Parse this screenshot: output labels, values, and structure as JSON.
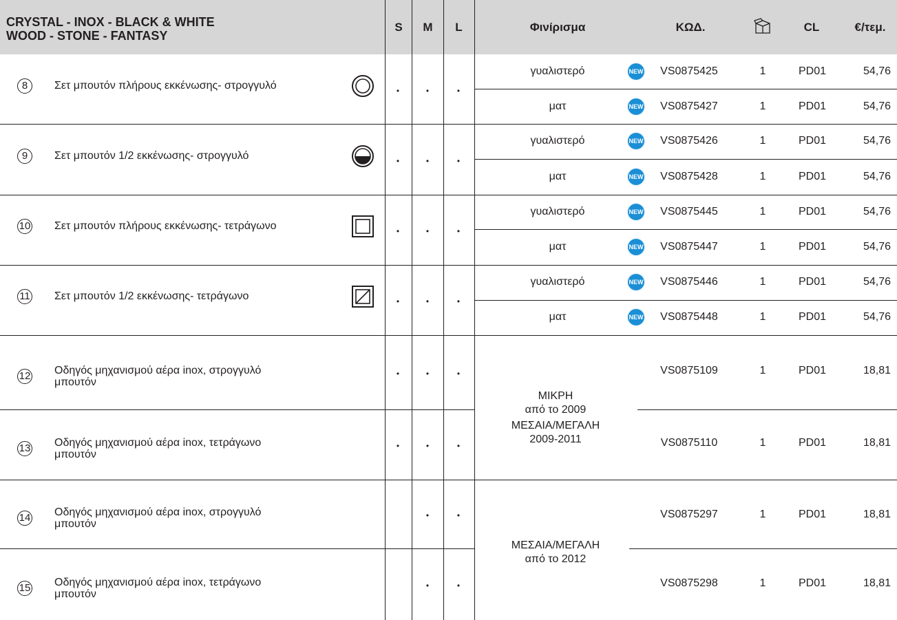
{
  "header": {
    "title_line1": "CRYSTAL - INOX - BLACK & WHITE",
    "title_line2": "WOOD - STONE - FANTASY",
    "col_s": "S",
    "col_m": "M",
    "col_l": "L",
    "col_finish": "Φινίρισμα",
    "col_code": "ΚΩΔ.",
    "col_box_icon": "box-icon",
    "col_cl": "CL",
    "col_price": "€/τεμ."
  },
  "badge_text": "NEW",
  "dot": "•",
  "groups": [
    {
      "num": "8",
      "desc_line1": "Σετ μπουτόν πλήρους εκκένωσης- στρογγυλό",
      "desc_line2": "",
      "icon": "round-full-flush-icon",
      "s": "•",
      "m": "•",
      "l": "•"
    },
    {
      "num": "9",
      "desc_line1": "Σετ μπουτόν 1/2 εκκένωσης- στρογγυλό",
      "desc_line2": "",
      "icon": "round-half-flush-icon",
      "s": "•",
      "m": "•",
      "l": "•"
    },
    {
      "num": "10",
      "desc_line1": "Σετ μπουτόν πλήρους εκκένωσης- τετράγωνο",
      "desc_line2": "",
      "icon": "square-full-flush-icon",
      "s": "•",
      "m": "•",
      "l": "•"
    },
    {
      "num": "11",
      "desc_line1": "Σετ μπουτόν 1/2 εκκένωσης- τετράγωνο",
      "desc_line2": "",
      "icon": "square-half-flush-icon",
      "s": "•",
      "m": "•",
      "l": "•"
    },
    {
      "num": "12",
      "desc_line1": "Οδηγός μηχανισμού αέρα inox, στρογγυλό",
      "desc_line2": "μπουτόν",
      "icon": "",
      "s": "•",
      "m": "•",
      "l": "•"
    },
    {
      "num": "13",
      "desc_line1": "Οδηγός μηχανισμού αέρα inox, τετράγωνο",
      "desc_line2": "μπουτόν",
      "icon": "",
      "s": "•",
      "m": "•",
      "l": "•"
    },
    {
      "num": "14",
      "desc_line1": "Οδηγός μηχανισμού αέρα inox, στρογγυλό",
      "desc_line2": "μπουτόν",
      "icon": "",
      "s": "",
      "m": "•",
      "l": "•"
    },
    {
      "num": "15",
      "desc_line1": "Οδηγός μηχανισμού αέρα inox, τετράγωνο",
      "desc_line2": "μπουτόν",
      "icon": "",
      "s": "",
      "m": "•",
      "l": "•"
    }
  ],
  "rows": [
    {
      "finish": "γυαλιστερό",
      "new": true,
      "code": "VS0875425",
      "qty": "1",
      "cl": "PD01",
      "price": "54,76"
    },
    {
      "finish": "ματ",
      "new": true,
      "code": "VS0875427",
      "qty": "1",
      "cl": "PD01",
      "price": "54,76"
    },
    {
      "finish": "γυαλιστερό",
      "new": true,
      "code": "VS0875426",
      "qty": "1",
      "cl": "PD01",
      "price": "54,76"
    },
    {
      "finish": "ματ",
      "new": true,
      "code": "VS0875428",
      "qty": "1",
      "cl": "PD01",
      "price": "54,76"
    },
    {
      "finish": "γυαλιστερό",
      "new": true,
      "code": "VS0875445",
      "qty": "1",
      "cl": "PD01",
      "price": "54,76"
    },
    {
      "finish": "ματ",
      "new": true,
      "code": "VS0875447",
      "qty": "1",
      "cl": "PD01",
      "price": "54,76"
    },
    {
      "finish": "γυαλιστερό",
      "new": true,
      "code": "VS0875446",
      "qty": "1",
      "cl": "PD01",
      "price": "54,76"
    },
    {
      "finish": "ματ",
      "new": true,
      "code": "VS0875448",
      "qty": "1",
      "cl": "PD01",
      "price": "54,76"
    },
    {
      "finish": "",
      "new": false,
      "code": "VS0875109",
      "qty": "1",
      "cl": "PD01",
      "price": "18,81"
    },
    {
      "finish": "",
      "new": false,
      "code": "VS0875110",
      "qty": "1",
      "cl": "PD01",
      "price": "18,81"
    },
    {
      "finish": "",
      "new": false,
      "code": "VS0875297",
      "qty": "1",
      "cl": "PD01",
      "price": "18,81"
    },
    {
      "finish": "",
      "new": false,
      "code": "VS0875298",
      "qty": "1",
      "cl": "PD01",
      "price": "18,81"
    }
  ],
  "merged_finish": [
    {
      "line1": "ΜΙΚΡΗ",
      "line2": "από το 2009"
    },
    {
      "line1": "ΜΕΣΑΙΑ/ΜΕΓΑΛΗ",
      "line2": "2009-2011"
    },
    {
      "line1": "ΜΕΣΑΙΑ/ΜΕΓΑΛΗ",
      "line2": "από το 2012"
    }
  ]
}
